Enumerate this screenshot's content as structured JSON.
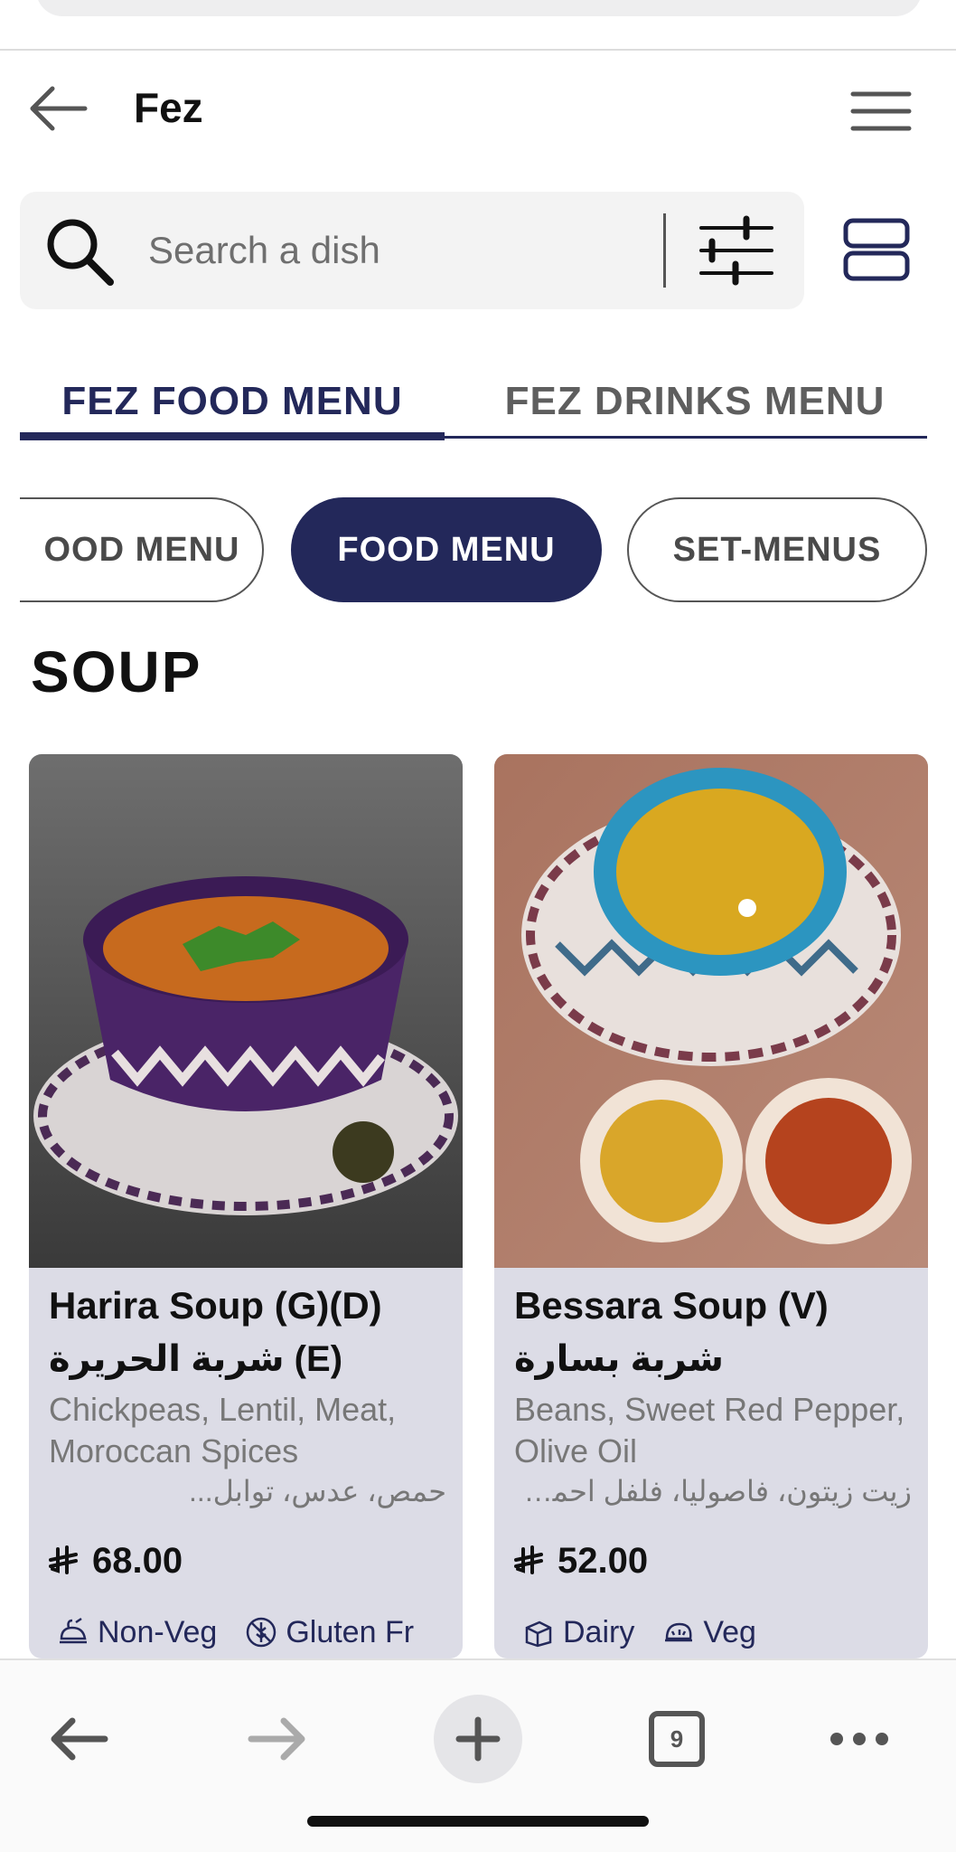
{
  "header": {
    "title": "Fez",
    "back_icon": "back-arrow-icon",
    "menu_icon": "hamburger-menu-icon"
  },
  "search": {
    "placeholder": "Search a dish",
    "value": ""
  },
  "tabs": [
    {
      "label": "FEZ FOOD MENU",
      "active": true
    },
    {
      "label": "FEZ DRINKS MENU",
      "active": false
    }
  ],
  "chips": [
    {
      "label": "OOD MENU",
      "active": false
    },
    {
      "label": "FOOD MENU",
      "active": true
    },
    {
      "label": "SET-MENUS",
      "active": false
    }
  ],
  "section": {
    "title": "SOUP"
  },
  "dishes": [
    {
      "name": "Harira Soup (G)(D)",
      "name_ar": "(E) شربة الحريرة",
      "description": "Chickpeas, Lentil, Meat, Moroccan Spices",
      "description_ar": "حمص، عدس، توابل...",
      "price": "68.00",
      "tags": [
        "Non-Veg",
        "Gluten Fr"
      ]
    },
    {
      "name": "Bessara Soup (V)",
      "name_ar": "شربة بسارة",
      "description": "Beans, Sweet Red Pepper, Olive Oil",
      "description_ar": "زيت زيتون، فاصوليا، فلفل احمر حلو",
      "price": "52.00",
      "tags": [
        "Dairy",
        "Veg"
      ]
    }
  ],
  "browser_nav": {
    "tab_count": "9"
  },
  "colors": {
    "accent": "#23285a",
    "card_bg": "#dcdce6",
    "search_bg": "#f3f3f3"
  }
}
